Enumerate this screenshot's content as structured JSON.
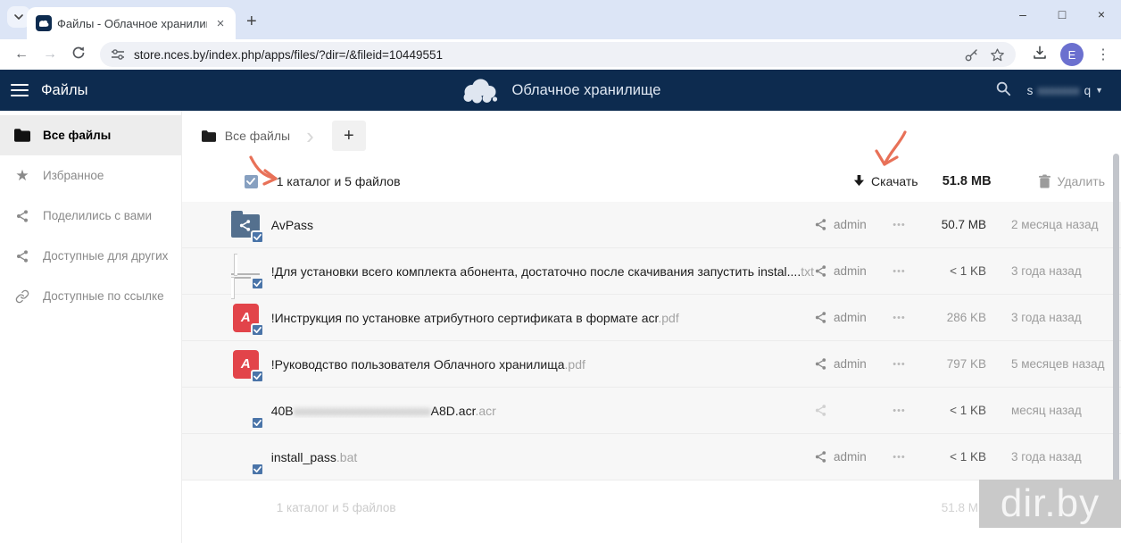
{
  "browser": {
    "tab_title": "Файлы - Облачное хранилище",
    "new_tab_label": "+",
    "url": "store.nces.by/index.php/apps/files/?dir=/&fileid=10449551",
    "avatar_letter": "E",
    "window_controls": {
      "minimize": "–",
      "maximize": "□",
      "close": "×"
    },
    "tab_close": "×",
    "back": "←",
    "forward": "→"
  },
  "app": {
    "app_name": "Файлы",
    "brand": "Облачное хранилище",
    "user_prefix": "s",
    "user_redacted": "xxxxxxx",
    "user_suffix": "q",
    "caret": "▼"
  },
  "sidebar": {
    "items": [
      {
        "label": "Все файлы"
      },
      {
        "label": "Избранное"
      },
      {
        "label": "Поделились с вами"
      },
      {
        "label": "Доступные для других"
      },
      {
        "label": "Доступные по ссылке"
      }
    ]
  },
  "breadcrumb": {
    "root": "Все файлы",
    "chevron": "›",
    "new_button": "+"
  },
  "toolbar": {
    "summary": "1 каталог и 5 файлов",
    "download_label": "Скачать",
    "total_size": "51.8 MB",
    "delete_label": "Удалить"
  },
  "files": [
    {
      "name": "AvPass",
      "ext": "",
      "owner": "admin",
      "more": "•••",
      "size": "50.7 MB",
      "date": "2 месяца назад"
    },
    {
      "name": "!Для установки всего комплекта абонента, достаточно после скачивания запустить instal....",
      "ext": "txt",
      "owner": "admin",
      "more": "•••",
      "size": "< 1 KB",
      "date": "3 года назад"
    },
    {
      "name": "!Инструкция по установке атрибутного сертификата в формате acr",
      "ext": ".pdf",
      "owner": "admin",
      "more": "•••",
      "size": "286 KB",
      "date": "3 года назад"
    },
    {
      "name": "!Руководство пользователя Облачного хранилища",
      "ext": ".pdf",
      "owner": "admin",
      "more": "•••",
      "size": "797 KB",
      "date": "5 месяцев назад"
    },
    {
      "name_prefix": "40B",
      "name_redacted": "xxxxxxxxxxxxxxxxxxxxxx",
      "name_suffix": "A8D.acr",
      "ext": ".acr",
      "owner": "",
      "more": "•••",
      "size": "< 1 KB",
      "date": "месяц назад"
    },
    {
      "name": "install_pass",
      "ext": ".bat",
      "owner": "admin",
      "more": "•••",
      "size": "< 1 KB",
      "date": "3 года назад"
    }
  ],
  "footer": {
    "summary": "1 каталог и 5 файлов",
    "total_size": "51.8 MB"
  },
  "watermark": "dir.by",
  "pdf_glyph": "A",
  "colors": {
    "header_navy": "#0d2b4f",
    "folder_blue": "#54708e",
    "badge_blue": "#4a74a8",
    "pdf_red": "#e2444a",
    "annotation_red": "#e4593c",
    "tabstrip": "#dce5f6"
  }
}
